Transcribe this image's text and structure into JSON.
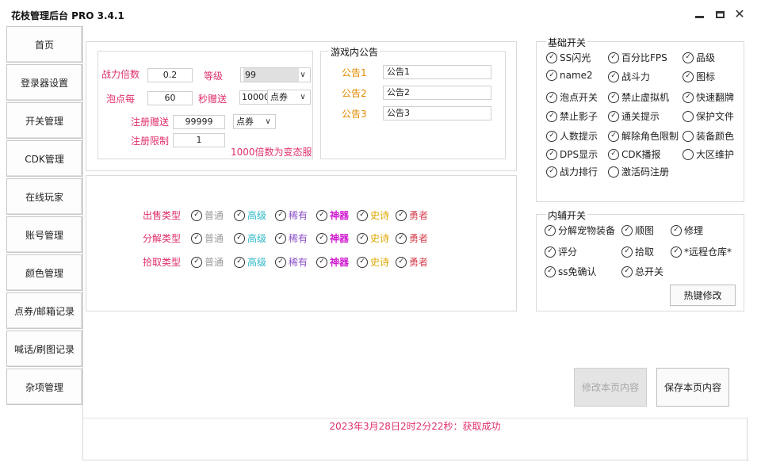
{
  "app": {
    "title": "花枝管理后台 PRO 3.4.1",
    "minimize_icon": "minimize-icon",
    "maximize_icon": "maximize-icon",
    "close_icon": "close-icon",
    "close_glyph": "✕"
  },
  "sidebar": {
    "items": [
      "首页",
      "登录器设置",
      "开关管理",
      "CDK管理",
      "在线玩家",
      "账号管理",
      "颜色管理",
      "点券/邮箱记录",
      "喊话/刷图记录",
      "杂项管理"
    ]
  },
  "settings": {
    "battle_mult_label": "战力倍数",
    "battle_mult_value": "0.2",
    "level_label": "等级",
    "level_value": "99",
    "bubble_label": "泡点每",
    "bubble_value": "60",
    "per_sec_label": "秒赠送",
    "per_sec_value": "10000",
    "per_sec_currency": "点券",
    "reg_gift_label": "注册赠送",
    "reg_gift_value": "99999",
    "reg_gift_currency": "点券",
    "reg_limit_label": "注册限制",
    "reg_limit_value": "1",
    "note": "1000倍数为变态服"
  },
  "announcements": {
    "legend": "游戏内公告",
    "items": [
      {
        "label": "公告1",
        "value": "公告1"
      },
      {
        "label": "公告2",
        "value": "公告2"
      },
      {
        "label": "公告3",
        "value": "公告3"
      }
    ]
  },
  "rarity": {
    "labels": [
      "普通",
      "高级",
      "稀有",
      "神器",
      "史诗",
      "勇者"
    ],
    "rows": [
      {
        "label": "出售类型"
      },
      {
        "label": "分解类型"
      },
      {
        "label": "拾取类型"
      }
    ]
  },
  "basic_switches": {
    "legend": "基础开关",
    "items": [
      {
        "label": "SS闪光",
        "checked": true
      },
      {
        "label": "百分比FPS",
        "checked": true
      },
      {
        "label": "品级",
        "checked": true
      },
      {
        "label": "name2",
        "checked": true
      },
      {
        "label": "战斗力",
        "checked": true
      },
      {
        "label": "图标",
        "checked": true
      },
      {
        "label": "泡点开关",
        "checked": true
      },
      {
        "label": "禁止虚拟机",
        "checked": true
      },
      {
        "label": "快速翻牌",
        "checked": true
      },
      {
        "label": "禁止影子",
        "checked": true
      },
      {
        "label": "通关提示",
        "checked": true
      },
      {
        "label": "保护文件",
        "checked": false
      },
      {
        "label": "人数提示",
        "checked": true
      },
      {
        "label": "解除角色限制",
        "checked": true
      },
      {
        "label": "装备颜色",
        "checked": false
      },
      {
        "label": "DPS显示",
        "checked": true
      },
      {
        "label": "CDK播报",
        "checked": true
      },
      {
        "label": "大区维护",
        "checked": false
      },
      {
        "label": "战力排行",
        "checked": true
      },
      {
        "label": "激活码注册",
        "checked": false
      }
    ]
  },
  "aux_switches": {
    "legend": "内辅开关",
    "items": [
      {
        "label": "分解宠物装备",
        "checked": true
      },
      {
        "label": "顺图",
        "checked": true
      },
      {
        "label": "修理",
        "checked": true
      },
      {
        "label": "评分",
        "checked": true
      },
      {
        "label": "拾取",
        "checked": true
      },
      {
        "label": "*远程仓库*",
        "checked": true
      },
      {
        "label": "ss免确认",
        "checked": true
      },
      {
        "label": "总开关",
        "checked": true
      }
    ],
    "hotkey_button": "热键修改"
  },
  "actions": {
    "modify_label": "修改本页内容",
    "save_label": "保存本页内容"
  },
  "status": {
    "message": "2023年3月28日2时2分22秒：获取成功"
  },
  "colors": {
    "pink": "#e0306a",
    "orange": "#e08a00",
    "grey": "#9a9a9a",
    "teal": "#2db8c8",
    "purple": "#8a4fc8",
    "magenta": "#d01ad0",
    "gold": "#e0a600",
    "red": "#d64050"
  }
}
